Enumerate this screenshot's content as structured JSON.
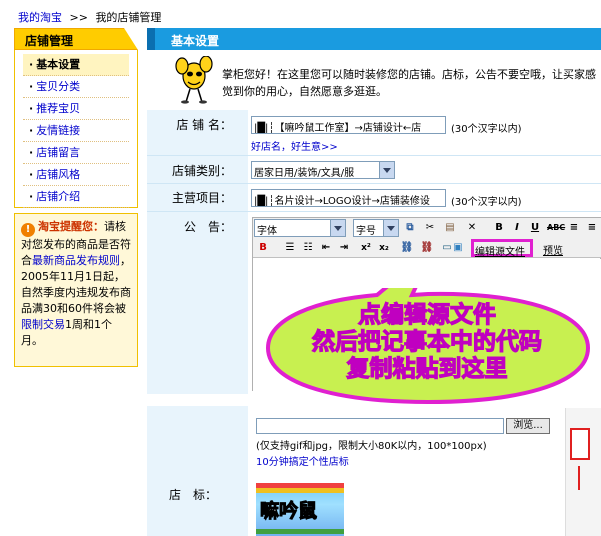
{
  "breadcrumb": {
    "root": "我的淘宝",
    "sep": ">>",
    "current": "我的店铺管理"
  },
  "sidebar": {
    "title": "店铺管理",
    "items": [
      {
        "label": "基本设置"
      },
      {
        "label": "宝贝分类"
      },
      {
        "label": "推荐宝贝"
      },
      {
        "label": "友情链接"
      },
      {
        "label": "店铺留言"
      },
      {
        "label": "店铺风格"
      },
      {
        "label": "店铺介绍"
      }
    ],
    "tip": {
      "title": "淘宝提醒您：",
      "text1": "请核对您发布的商品是否符合",
      "link1": "最新商品发布规则",
      "text2": "，2005年11月1日起，自然季度内违规发布商品满30和60件将会被",
      "link2": "限制交易",
      "text3": "1周和1个月。"
    }
  },
  "main": {
    "title": "基本设置",
    "intro": "掌柜您好！在这里您可以随时装修您的店铺。店标，公告不要空哦，让买家感觉到你的用心，自然愿意多逛逛。",
    "shop_name": {
      "label": "店 铺 名：",
      "value": "|█|┆【嘛吟鼠工作室】→店铺设计←店",
      "note": "(30个汉字以内)",
      "link": "好店名，好生意>>"
    },
    "category": {
      "label": "店铺类别：",
      "value": "居家日用/装饰/文具/服"
    },
    "main_business": {
      "label": "主营项目：",
      "value": "|█|┆名片设计→LOGO设计→店铺装修设",
      "note": "(30个汉字以内)"
    },
    "announcement": {
      "label": "公　告：",
      "font_label": "字体",
      "size_label": "字号",
      "edit_source": "编辑源文件",
      "preview": "预览"
    },
    "callout": {
      "line1": "点编辑源文件",
      "line2": "然后把记事本中的代码",
      "line3": "复制粘贴到这里"
    },
    "logo": {
      "label": "店　标：",
      "browse": "浏览...",
      "hint": "(仅支持gif和jpg，限制大小80K以内，100*100px)",
      "link": "10分钟搞定个性店标",
      "image_text": "嘛吟鼠"
    }
  },
  "colors": {
    "header_blue": "#1a9be0",
    "sidebar_yellow": "#ffcc00",
    "callout_magenta": "#e020d0",
    "callout_green": "#c8f050"
  }
}
